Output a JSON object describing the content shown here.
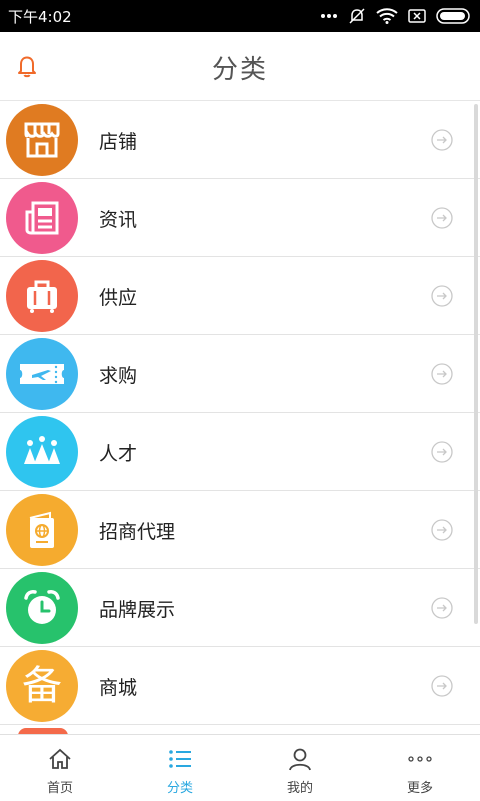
{
  "status_bar": {
    "time": "下午4:02"
  },
  "header": {
    "title": "分类"
  },
  "categories": [
    {
      "label": "店铺",
      "color": "#e07b21",
      "icon": "store-icon"
    },
    {
      "label": "资讯",
      "color": "#f05a8d",
      "icon": "newspaper-icon"
    },
    {
      "label": "供应",
      "color": "#f2654c",
      "icon": "suitcase-icon"
    },
    {
      "label": "求购",
      "color": "#3fb8ef",
      "icon": "ticket-icon"
    },
    {
      "label": "人才",
      "color": "#2fc5ef",
      "icon": "crown-icon"
    },
    {
      "label": "招商代理",
      "color": "#f5ab2f",
      "icon": "passport-icon"
    },
    {
      "label": "品牌展示",
      "color": "#27c26c",
      "icon": "alarm-clock-icon"
    },
    {
      "label": "商城",
      "color": "#f6ac33",
      "icon": "mall-glyph-icon",
      "glyph": "备"
    }
  ],
  "tabbar": {
    "active_color": "#2aa8e0",
    "items": [
      {
        "label": "首页",
        "icon": "home-icon"
      },
      {
        "label": "分类",
        "icon": "list-icon"
      },
      {
        "label": "我的",
        "icon": "user-icon"
      },
      {
        "label": "更多",
        "icon": "more-dots-icon"
      }
    ]
  }
}
